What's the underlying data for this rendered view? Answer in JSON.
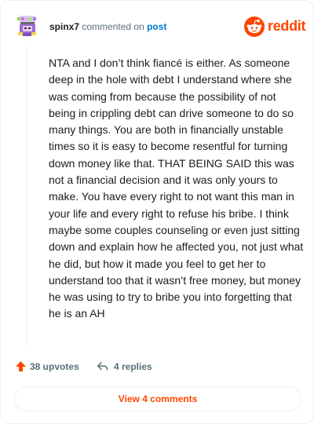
{
  "header": {
    "username": "spinx7",
    "verb": "commented on",
    "post_link": "post",
    "brand_word": "reddit",
    "avatar_icon": "pixel-avatar-icon",
    "brand_icon": "reddit-snoo-icon"
  },
  "comment": {
    "body": "NTA and I don’t think fiancé is either. As someone deep in the hole with debt I understand where she was coming from because the possibility of not being in crippling debt can drive someone to do so many things. You are both in financially unstable times so it is easy to become resentful for turning down money like that. THAT BEING SAID this was not a financial decision and it was only yours to make. You have every right to not want this man in your life and every right to refuse his bribe. I think maybe some couples counseling or even just sitting down and explain how he affected you, not just what he did, but how it made you feel to get her to understand too that it wasn’t free money, but money he was using to try to bribe you into forgetting that he is an AH"
  },
  "footer": {
    "upvotes": "38 upvotes",
    "replies": "4 replies",
    "view_button": "View 4 comments"
  },
  "colors": {
    "brand": "#ff4500",
    "link": "#0079d3",
    "muted": "#576f76",
    "border": "#edeff1"
  }
}
